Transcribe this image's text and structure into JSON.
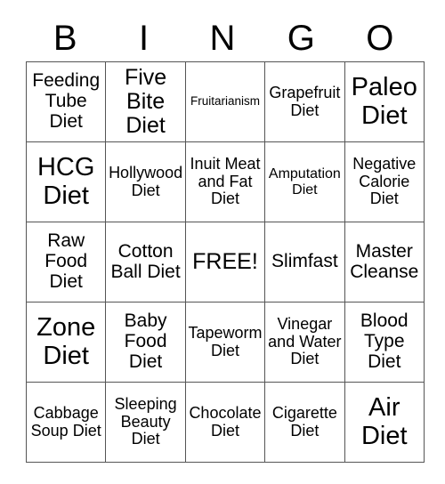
{
  "card": {
    "header": {
      "letters": [
        "B",
        "I",
        "N",
        "G",
        "O"
      ]
    },
    "rows": [
      [
        {
          "text": "Feeding Tube Diet",
          "size": "l"
        },
        {
          "text": "Five Bite Diet",
          "size": "xl"
        },
        {
          "text": "Fruitarianism",
          "size": "xs"
        },
        {
          "text": "Grapefruit Diet",
          "size": "m"
        },
        {
          "text": "Paleo Diet",
          "size": "xxl"
        }
      ],
      [
        {
          "text": "HCG Diet",
          "size": "xxl"
        },
        {
          "text": "Hollywood Diet",
          "size": "m"
        },
        {
          "text": "Inuit Meat and Fat Diet",
          "size": "m"
        },
        {
          "text": "Amputation Diet",
          "size": "s"
        },
        {
          "text": "Negative Calorie Diet",
          "size": "m"
        }
      ],
      [
        {
          "text": "Raw Food Diet",
          "size": "l"
        },
        {
          "text": "Cotton Ball Diet",
          "size": "l"
        },
        {
          "text": "FREE!",
          "size": "xl"
        },
        {
          "text": "Slimfast",
          "size": "l"
        },
        {
          "text": "Master Cleanse",
          "size": "l"
        }
      ],
      [
        {
          "text": "Zone Diet",
          "size": "xxl"
        },
        {
          "text": "Baby Food Diet",
          "size": "l"
        },
        {
          "text": "Tapeworm Diet",
          "size": "m"
        },
        {
          "text": "Vinegar and Water Diet",
          "size": "m"
        },
        {
          "text": "Blood Type Diet",
          "size": "l"
        }
      ],
      [
        {
          "text": "Cabbage Soup Diet",
          "size": "m"
        },
        {
          "text": "Sleeping Beauty Diet",
          "size": "m"
        },
        {
          "text": "Chocolate Diet",
          "size": "m"
        },
        {
          "text": "Cigarette Diet",
          "size": "m"
        },
        {
          "text": "Air Diet",
          "size": "xxl"
        }
      ]
    ]
  },
  "colors": {
    "border": "#555555",
    "text": "#000000",
    "background": "#ffffff"
  }
}
